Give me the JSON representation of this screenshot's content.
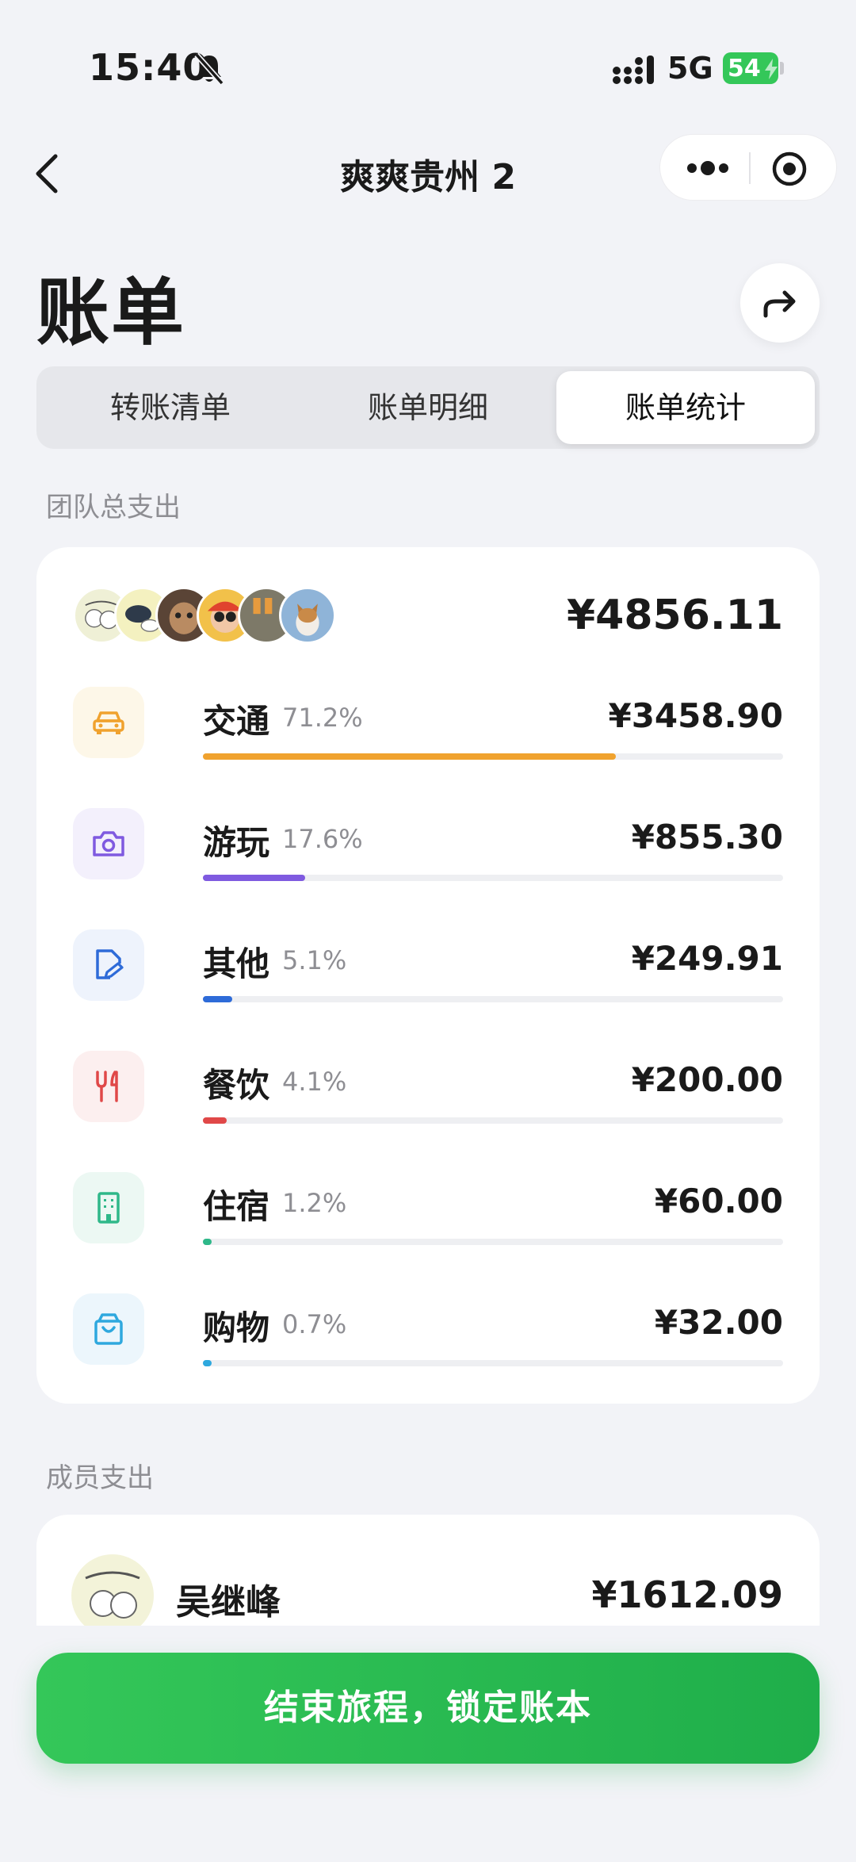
{
  "status_bar": {
    "time": "15:40",
    "network": "5G",
    "battery": "54"
  },
  "nav": {
    "title": "爽爽贵州 2"
  },
  "header": {
    "title": "账单"
  },
  "tabs": [
    {
      "label": "转账清单",
      "active": false
    },
    {
      "label": "账单明细",
      "active": false
    },
    {
      "label": "账单统计",
      "active": true
    }
  ],
  "team": {
    "section_label": "团队总支出",
    "total": "¥4856.11",
    "categories": [
      {
        "name": "交通",
        "percent_label": "71.2%",
        "percent": 71.2,
        "amount": "¥3458.90",
        "icon": "car-icon",
        "color": "#F0A22E",
        "bg": "#FDF7E8"
      },
      {
        "name": "游玩",
        "percent_label": "17.6%",
        "percent": 17.6,
        "amount": "¥855.30",
        "icon": "camera-icon",
        "color": "#7F5AE0",
        "bg": "#F3F0FC"
      },
      {
        "name": "其他",
        "percent_label": "5.1%",
        "percent": 5.1,
        "amount": "¥249.91",
        "icon": "edit-doc-icon",
        "color": "#2E6BD8",
        "bg": "#EEF3FC"
      },
      {
        "name": "餐饮",
        "percent_label": "4.1%",
        "percent": 4.1,
        "amount": "¥200.00",
        "icon": "fork-knife-icon",
        "color": "#E04848",
        "bg": "#FCEFEF"
      },
      {
        "name": "住宿",
        "percent_label": "1.2%",
        "percent": 1.2,
        "amount": "¥60.00",
        "icon": "building-icon",
        "color": "#2FB889",
        "bg": "#ECF8F3"
      },
      {
        "name": "购物",
        "percent_label": "0.7%",
        "percent": 0.7,
        "amount": "¥32.00",
        "icon": "shopping-bag-icon",
        "color": "#2EA8DE",
        "bg": "#ECF6FC"
      }
    ]
  },
  "members": {
    "section_label": "成员支出",
    "items": [
      {
        "name": "吴继峰",
        "amount": "¥1612.09"
      }
    ]
  },
  "footer": {
    "button_label": "结束旅程，锁定账本"
  }
}
